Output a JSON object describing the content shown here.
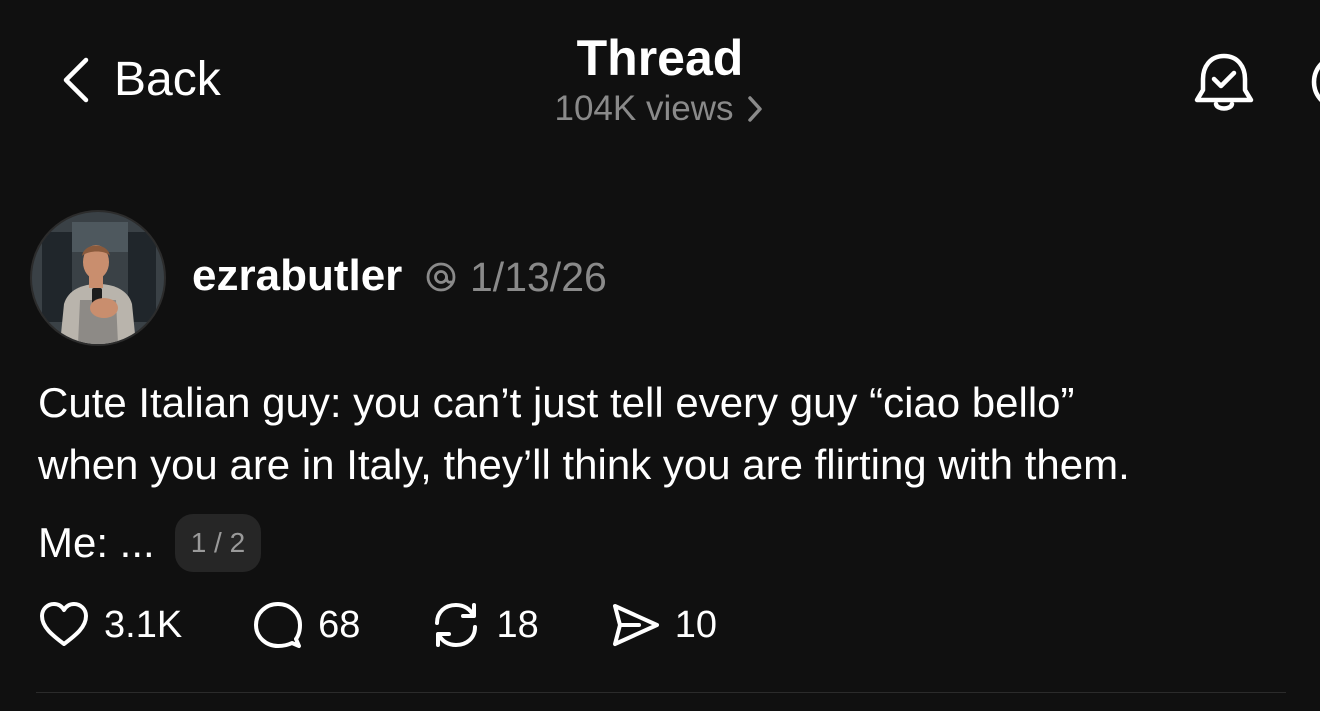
{
  "header": {
    "back_label": "Back",
    "title": "Thread",
    "views": "104K views"
  },
  "post": {
    "username": "ezrabutler",
    "date": "1/13/26",
    "lines": [
      "Cute Italian guy: you can’t just tell every guy “ciao bello”",
      "when you are in Italy, they’ll think you are flirting with them.",
      "Me: ..."
    ],
    "page_indicator": "1 / 2"
  },
  "actions": {
    "likes": "3.1K",
    "replies": "68",
    "reposts": "18",
    "shares": "10"
  },
  "icons": {
    "back": "chevron-left-icon",
    "views": "chevron-right-icon",
    "bell": "bell-check-icon",
    "threads": "threads-logo-icon",
    "like": "heart-icon",
    "reply": "comment-icon",
    "repost": "repost-icon",
    "share": "send-icon"
  },
  "colors": {
    "background": "#101010",
    "text_primary": "#ffffff",
    "text_secondary": "#8a8a8a",
    "badge_background": "#262626",
    "divider": "#2b2b2b"
  }
}
